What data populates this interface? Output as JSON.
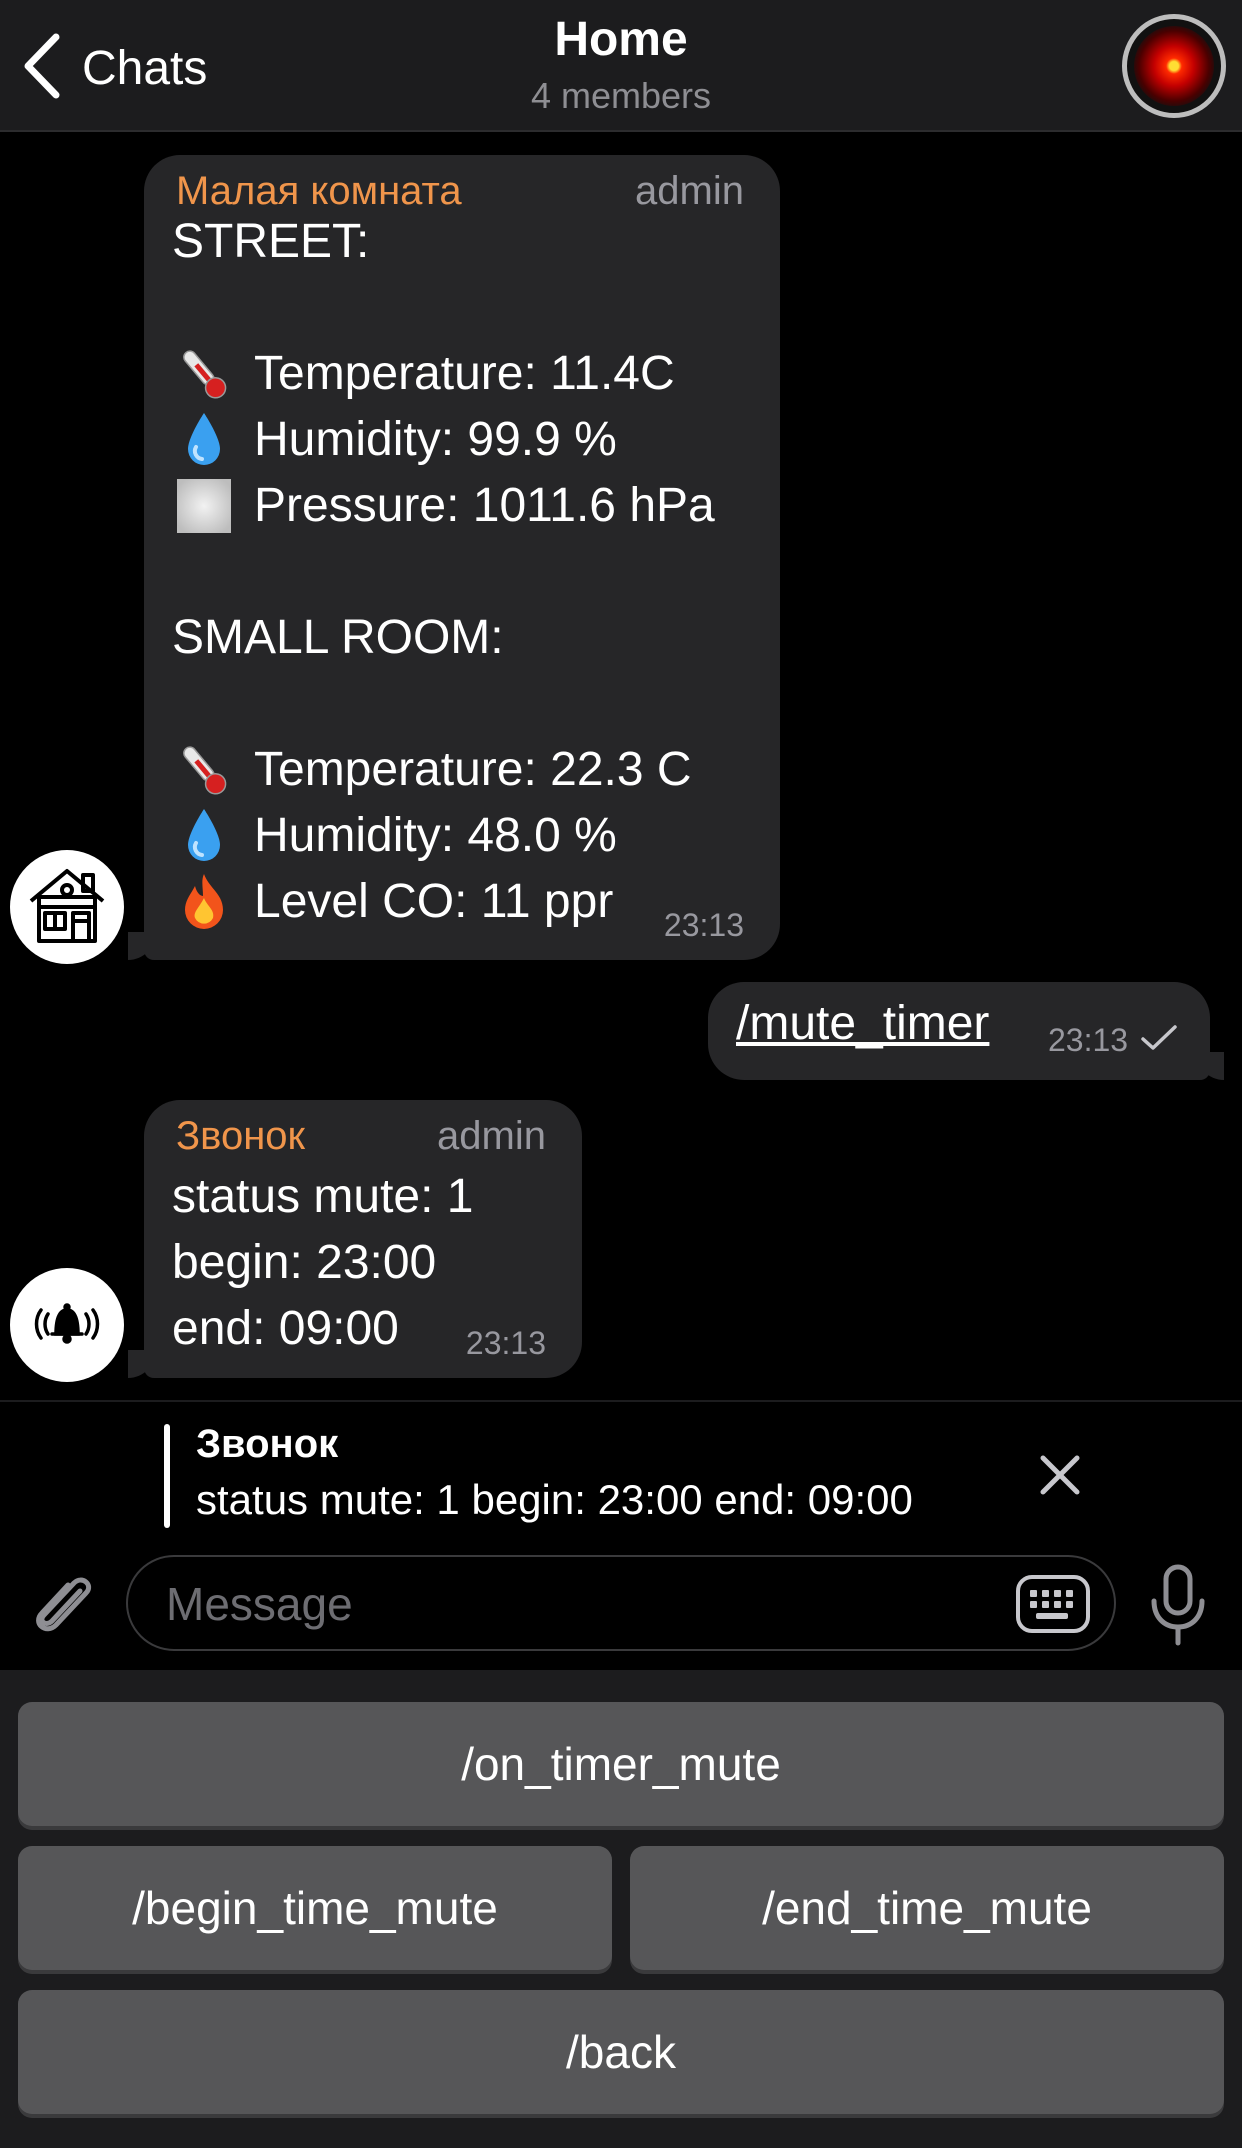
{
  "header": {
    "back_label": "Chats",
    "title": "Home",
    "subtitle": "4 members"
  },
  "messages": [
    {
      "sender": "Малая комната",
      "role": "admin",
      "lines": [
        {
          "icon": "",
          "text": "STREET:"
        },
        {
          "icon": "",
          "text": ""
        },
        {
          "icon": "thermometer-icon",
          "text": "Temperature: 11.4C"
        },
        {
          "icon": "droplet-icon",
          "text": "Humidity: 99.9 %"
        },
        {
          "icon": "fog-icon",
          "text": "Pressure: 1011.6 hPa"
        },
        {
          "icon": "",
          "text": ""
        },
        {
          "icon": "",
          "text": "SMALL ROOM:"
        },
        {
          "icon": "",
          "text": ""
        },
        {
          "icon": "thermometer-icon",
          "text": "Temperature: 22.3 C"
        },
        {
          "icon": "droplet-icon",
          "text": "Humidity: 48.0 %"
        },
        {
          "icon": "fire-icon",
          "text": "Level CO: 11 ppr"
        }
      ],
      "time": "23:13"
    },
    {
      "outgoing": true,
      "text": "/mute_timer",
      "time": "23:13"
    },
    {
      "sender": "Звонок",
      "role": "admin",
      "lines": [
        {
          "text": "status mute: 1"
        },
        {
          "text": "begin: 23:00"
        },
        {
          "text": "end: 09:00"
        }
      ],
      "time": "23:13"
    }
  ],
  "reply": {
    "title": "Звонок",
    "text": "status mute: 1 begin: 23:00 end: 09:00"
  },
  "composer": {
    "placeholder": "Message"
  },
  "keyboard": {
    "on_timer_mute": "/on_timer_mute",
    "begin_time_mute": "/begin_time_mute",
    "end_time_mute": "/end_time_mute",
    "back": "/back"
  },
  "colors": {
    "background": "#000000",
    "bubble": "#262628",
    "sender_name": "#f0954b",
    "secondary_text": "#98989f",
    "keyboard_button": "#565658"
  }
}
